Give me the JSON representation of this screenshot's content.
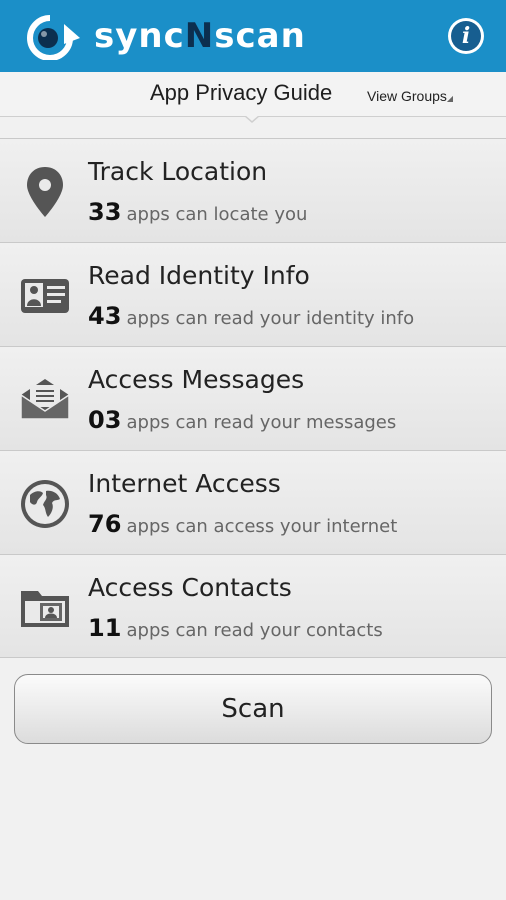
{
  "header": {
    "logo_part1": "sync",
    "logo_part2": "N",
    "logo_part3": "scan",
    "info_icon": "info-icon",
    "info_glyph": "i"
  },
  "subheader": {
    "title": "App Privacy Guide",
    "view_groups": "View Groups"
  },
  "items": [
    {
      "icon": "location-pin-icon",
      "title": "Track Location",
      "count": "33",
      "desc": "apps can locate you"
    },
    {
      "icon": "identity-card-icon",
      "title": "Read Identity Info",
      "count": "43",
      "desc": "apps can read your identity info"
    },
    {
      "icon": "envelope-icon",
      "title": "Access Messages",
      "count": "03",
      "desc": "apps can read your messages"
    },
    {
      "icon": "globe-icon",
      "title": "Internet Access",
      "count": "76",
      "desc": "apps can access your internet"
    },
    {
      "icon": "contacts-folder-icon",
      "title": "Access Contacts",
      "count": "11",
      "desc": "apps can read your contacts"
    }
  ],
  "scan_label": "Scan",
  "colors": {
    "topbar": "#1b8fc8",
    "logo_accent": "#0c2f4f",
    "icon_gray": "#555555"
  }
}
